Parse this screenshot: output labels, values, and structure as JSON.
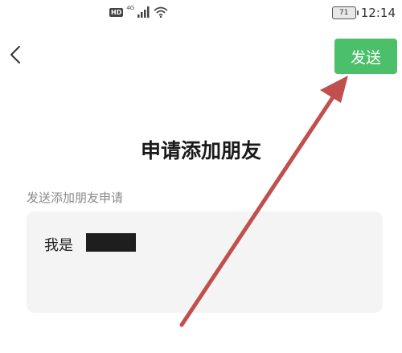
{
  "status_bar": {
    "hd_badge": "HD",
    "network": "4G",
    "battery_level": "71",
    "time": "12:14"
  },
  "header": {
    "back_icon": "chevron-left-icon",
    "send_button_label": "发送"
  },
  "page": {
    "title": "申请添加朋友",
    "section_label": "发送添加朋友申请",
    "message_text": "我是"
  },
  "colors": {
    "accent": "#4cbf6b",
    "annotation_arrow": "#c0504d",
    "input_background": "#f4f4f4"
  }
}
